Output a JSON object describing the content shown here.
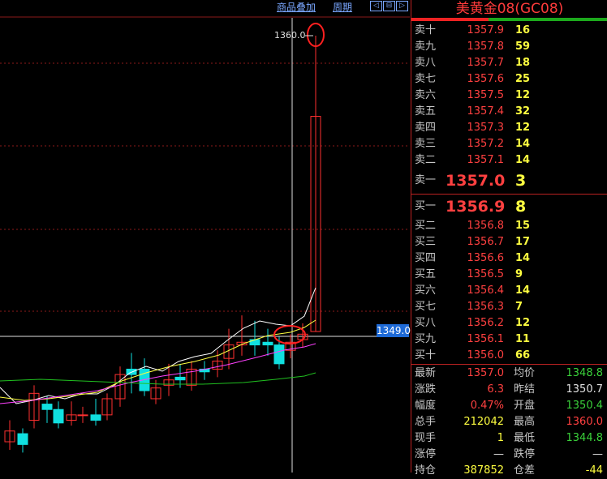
{
  "toolbar": {
    "overlay_label": "商品叠加",
    "period_label": "周期",
    "nav_left": "◁",
    "nav_mid": "⊟",
    "nav_right": "▷"
  },
  "chart": {
    "high_marker_label": "1360.0",
    "current_price_tag": "1349.0"
  },
  "quote": {
    "title": "美黄金08(GC08)",
    "asks": [
      {
        "label": "卖十",
        "price": "1357.9",
        "vol": "16"
      },
      {
        "label": "卖九",
        "price": "1357.8",
        "vol": "59"
      },
      {
        "label": "卖八",
        "price": "1357.7",
        "vol": "18"
      },
      {
        "label": "卖七",
        "price": "1357.6",
        "vol": "25"
      },
      {
        "label": "卖六",
        "price": "1357.5",
        "vol": "12"
      },
      {
        "label": "卖五",
        "price": "1357.4",
        "vol": "32"
      },
      {
        "label": "卖四",
        "price": "1357.3",
        "vol": "12"
      },
      {
        "label": "卖三",
        "price": "1357.2",
        "vol": "14"
      },
      {
        "label": "卖二",
        "price": "1357.1",
        "vol": "14"
      },
      {
        "label": "卖一",
        "price": "1357.0",
        "vol": "3"
      }
    ],
    "bids": [
      {
        "label": "买一",
        "price": "1356.9",
        "vol": "8"
      },
      {
        "label": "买二",
        "price": "1356.8",
        "vol": "15"
      },
      {
        "label": "买三",
        "price": "1356.7",
        "vol": "17"
      },
      {
        "label": "买四",
        "price": "1356.6",
        "vol": "14"
      },
      {
        "label": "买五",
        "price": "1356.5",
        "vol": "9"
      },
      {
        "label": "买六",
        "price": "1356.4",
        "vol": "14"
      },
      {
        "label": "买七",
        "price": "1356.3",
        "vol": "7"
      },
      {
        "label": "买八",
        "price": "1356.2",
        "vol": "12"
      },
      {
        "label": "买九",
        "price": "1356.1",
        "vol": "11"
      },
      {
        "label": "买十",
        "price": "1356.0",
        "vol": "66"
      }
    ],
    "stats": [
      {
        "l1": "最新",
        "v1": "1357.0",
        "c1": "red",
        "l2": "均价",
        "v2": "1348.8",
        "c2": "green"
      },
      {
        "l1": "涨跌",
        "v1": "6.3",
        "c1": "red",
        "l2": "昨结",
        "v2": "1350.7",
        "c2": "white"
      },
      {
        "l1": "幅度",
        "v1": "0.47%",
        "c1": "red",
        "l2": "开盘",
        "v2": "1350.4",
        "c2": "green"
      },
      {
        "l1": "总手",
        "v1": "212042",
        "c1": "yellow",
        "l2": "最高",
        "v2": "1360.0",
        "c2": "red"
      },
      {
        "l1": "现手",
        "v1": "1",
        "c1": "yellow",
        "l2": "最低",
        "v2": "1344.8",
        "c2": "green"
      },
      {
        "l1": "涨停",
        "v1": "—",
        "c1": "white",
        "l2": "跌停",
        "v2": "—",
        "c2": "white"
      },
      {
        "l1": "持仓",
        "v1": "387852",
        "c1": "yellow",
        "l2": "仓差",
        "v2": "-44",
        "c2": "yellow"
      }
    ]
  },
  "colors": {
    "up": "#ff3030",
    "down": "#10e0e0",
    "ma_white": "#ffffff",
    "ma_yellow": "#ffff40",
    "ma_magenta": "#ff40ff",
    "ma_green": "#20c020",
    "grid": "#8b1a1a"
  }
}
